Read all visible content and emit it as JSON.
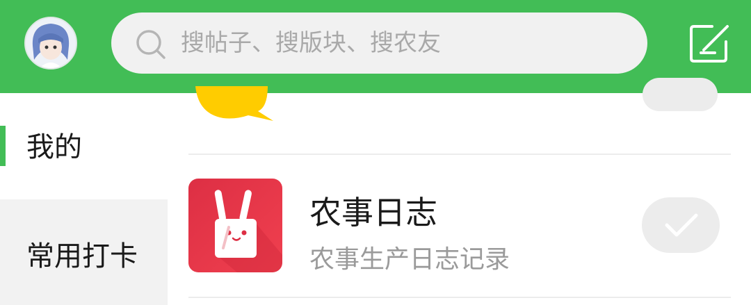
{
  "header": {
    "search": {
      "placeholder": "搜帖子、搜版块、搜农友",
      "value": ""
    },
    "avatar_icon": "user-avatar",
    "compose_icon": "compose-icon"
  },
  "sidebar": {
    "items": [
      {
        "label": "我的",
        "active": true
      },
      {
        "label": "常用打卡",
        "active": false
      }
    ]
  },
  "apps": [
    {
      "title": "农事日志",
      "subtitle": "农事生产日志记录",
      "icon": "rabbit-ears-icon",
      "added": true
    }
  ],
  "colors": {
    "brand_green": "#42bd56",
    "search_bg": "#f1f1f1",
    "app_icon_red": "#e8394a",
    "bubble_yellow": "#ffcc00"
  }
}
